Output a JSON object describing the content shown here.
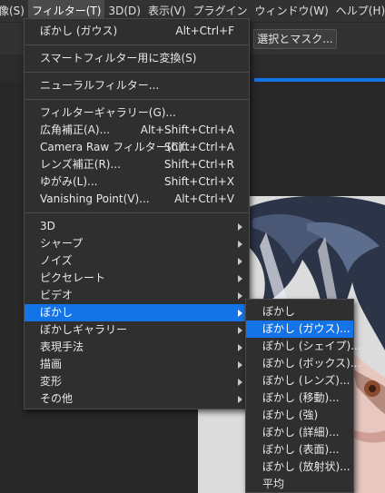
{
  "menubar": {
    "items": [
      {
        "label": "画像(S)"
      },
      {
        "label": "フィルター(T)"
      },
      {
        "label": "3D(D)"
      },
      {
        "label": "表示(V)"
      },
      {
        "label": "プラグイン"
      },
      {
        "label": "ウィンドウ(W)"
      },
      {
        "label": "ヘルプ(H)"
      }
    ]
  },
  "options_bar": {
    "select_and_mask_label": "選択とマスク..."
  },
  "filter_menu": {
    "last_filter": {
      "label": "ぼかし (ガウス)",
      "shortcut": "Alt+Ctrl+F"
    },
    "smart_filter": {
      "label": "スマートフィルター用に変換(S)"
    },
    "neural_filter": {
      "label": "ニューラルフィルター..."
    },
    "group3": [
      {
        "label": "フィルターギャラリー(G)...",
        "shortcut": ""
      },
      {
        "label": "広角補正(A)...",
        "shortcut": "Alt+Shift+Ctrl+A"
      },
      {
        "label": "Camera Raw フィルター(C)...",
        "shortcut": "Shift+Ctrl+A"
      },
      {
        "label": "レンズ補正(R)...",
        "shortcut": "Shift+Ctrl+R"
      },
      {
        "label": "ゆがみ(L)...",
        "shortcut": "Shift+Ctrl+X"
      },
      {
        "label": "Vanishing Point(V)...",
        "shortcut": "Alt+Ctrl+V"
      }
    ],
    "submenus": [
      {
        "label": "3D"
      },
      {
        "label": "シャープ"
      },
      {
        "label": "ノイズ"
      },
      {
        "label": "ピクセレート"
      },
      {
        "label": "ビデオ"
      },
      {
        "label": "ぼかし"
      },
      {
        "label": "ぼかしギャラリー"
      },
      {
        "label": "表現手法"
      },
      {
        "label": "描画"
      },
      {
        "label": "変形"
      },
      {
        "label": "その他"
      }
    ]
  },
  "blur_submenu": {
    "items": [
      {
        "label": "ぼかし"
      },
      {
        "label": "ぼかし (ガウス)..."
      },
      {
        "label": "ぼかし (シェイプ)..."
      },
      {
        "label": "ぼかし (ボックス)..."
      },
      {
        "label": "ぼかし (レンズ)..."
      },
      {
        "label": "ぼかし (移動)..."
      },
      {
        "label": "ぼかし (強)"
      },
      {
        "label": "ぼかし (詳細)..."
      },
      {
        "label": "ぼかし (表面)..."
      },
      {
        "label": "ぼかし (放射状)..."
      },
      {
        "label": "平均"
      }
    ]
  },
  "colors": {
    "menu_bg": "#2f2f2f",
    "highlight": "#1473e6",
    "menubar_bg": "#323232",
    "text": "#e8e8e8"
  }
}
